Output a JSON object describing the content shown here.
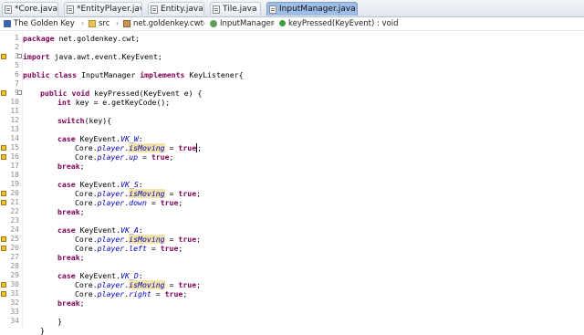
{
  "tabs": [
    {
      "label": "*Core.java"
    },
    {
      "label": "*EntityPlayer.java"
    },
    {
      "label": "Entity.java"
    },
    {
      "label": "Tile.java"
    },
    {
      "label": "InputManager.java",
      "active": true
    }
  ],
  "breadcrumb": {
    "project": "The Golden Key",
    "folder": "src",
    "package": "net.goldenkey.cwt",
    "class": "InputManager",
    "method": "keyPressed(KeyEvent) : void"
  },
  "line_numbers": [
    "1",
    "2",
    "3",
    "5",
    "6",
    "7",
    "9",
    "10",
    "11",
    "12",
    "13",
    "14",
    "15",
    "16",
    "17",
    "18",
    "19",
    "20",
    "21",
    "22",
    "23",
    "24",
    "25",
    "26",
    "27",
    "28",
    "29",
    "30",
    "31",
    "32",
    "33",
    "34"
  ],
  "code": {
    "l1": [
      "package",
      " net.goldenkey.cwt;"
    ],
    "l3": [
      "import",
      " java.awt.event.KeyEvent;"
    ],
    "l6": [
      "public",
      "class",
      " InputManager ",
      "implements",
      " KeyListener{"
    ],
    "l9": [
      "public",
      "void",
      " keyPressed(KeyEvent e) {"
    ],
    "l10": [
      "int",
      " key = e.getKeyCode();"
    ],
    "l12": [
      "switch",
      "(key){"
    ],
    "case_kw": "case",
    "keyevent": "KeyEvent.",
    "vk_w": "VK_W",
    "vk_s": "VK_S",
    "vk_a": "VK_A",
    "vk_d": "VK_D",
    "colon": ":",
    "core": "Core.",
    "player": "player",
    "dot": ".",
    "ismoving": "isMoving",
    "eq": " = ",
    "true_kw": "true",
    "semi": ";",
    "up": "up",
    "down": "down",
    "left": "left",
    "right": "right",
    "break_kw": "break",
    "close_brace": "}"
  },
  "colors": {
    "keyword": "#7f0055",
    "field": "#0000c0",
    "occurrence_highlight": "#f2e3a8",
    "active_tab": "#9fbde6"
  },
  "icons": [
    "java-file-icon",
    "project-icon",
    "folder-icon",
    "package-icon",
    "class-icon",
    "method-icon",
    "warning-icon",
    "fold-icon"
  ]
}
